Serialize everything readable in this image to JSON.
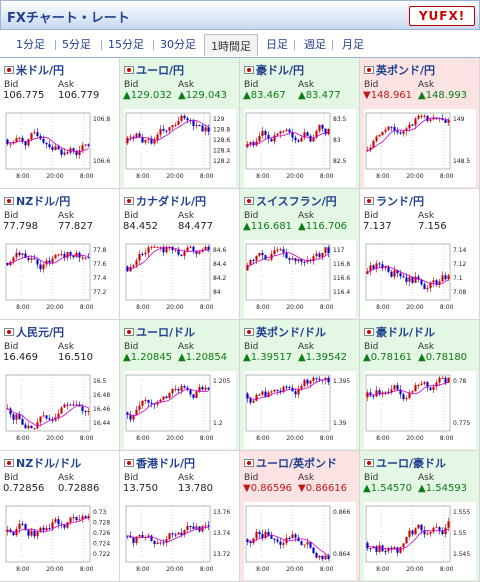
{
  "header": {
    "title": "FXチャート・レート",
    "logo": "YUFX!"
  },
  "tabs": [
    {
      "label": "1分足"
    },
    {
      "label": "5分足"
    },
    {
      "label": "15分足"
    },
    {
      "label": "30分足"
    },
    {
      "label": "1時間足"
    },
    {
      "label": "日足"
    },
    {
      "label": "週足"
    },
    {
      "label": "月足"
    }
  ],
  "active_tab": 4,
  "labels": {
    "bid": "Bid",
    "ask": "Ask"
  },
  "x_ticks": [
    "8:00",
    "20:00",
    "8:00"
  ],
  "colors": {
    "up_bg": "#e4f6e4",
    "down_bg": "#fbe3e3",
    "up_candle": "#c00",
    "down_candle": "#00c",
    "ma": "#c0c"
  },
  "pairs": [
    {
      "name": "米ドル/円",
      "bid": "106.775",
      "ask": "106.779",
      "trend": "neutral",
      "yticks": [
        "106.8",
        "106.6"
      ]
    },
    {
      "name": "ユーロ/円",
      "bid": "▲129.032",
      "ask": "▲129.043",
      "trend": "up",
      "yticks": [
        "129",
        "128.8",
        "128.6",
        "128.4",
        "128.2"
      ]
    },
    {
      "name": "豪ドル/円",
      "bid": "▲83.467",
      "ask": "▲83.477",
      "trend": "up",
      "yticks": [
        "83.5",
        "83",
        "82.5"
      ]
    },
    {
      "name": "英ポンド/円",
      "bid": "▼148.961",
      "ask": "▲148.993",
      "trend": "down",
      "yticks": [
        "149",
        "148.5"
      ]
    },
    {
      "name": "NZドル/円",
      "bid": "77.798",
      "ask": "77.827",
      "trend": "neutral",
      "yticks": [
        "77.8",
        "77.6",
        "77.4",
        "77.2"
      ]
    },
    {
      "name": "カナダドル/円",
      "bid": "84.452",
      "ask": "84.477",
      "trend": "neutral",
      "yticks": [
        "84.6",
        "84.4",
        "84.2",
        "84"
      ]
    },
    {
      "name": "スイスフラン/円",
      "bid": "▲116.681",
      "ask": "▲116.706",
      "trend": "up",
      "yticks": [
        "117",
        "116.8",
        "116.6",
        "116.4"
      ]
    },
    {
      "name": "ランド/円",
      "bid": "7.137",
      "ask": "7.156",
      "trend": "neutral",
      "yticks": [
        "7.14",
        "7.12",
        "7.1",
        "7.08"
      ]
    },
    {
      "name": "人民元/円",
      "bid": "16.469",
      "ask": "16.510",
      "trend": "neutral",
      "yticks": [
        "16.5",
        "16.48",
        "16.46",
        "16.44"
      ]
    },
    {
      "name": "ユーロ/ドル",
      "bid": "▲1.20845",
      "ask": "▲1.20854",
      "trend": "up",
      "yticks": [
        "1.205",
        "1.2"
      ]
    },
    {
      "name": "英ポンド/ドル",
      "bid": "▲1.39517",
      "ask": "▲1.39542",
      "trend": "up",
      "yticks": [
        "1.395",
        "1.39"
      ]
    },
    {
      "name": "豪ドル/ドル",
      "bid": "▲0.78161",
      "ask": "▲0.78180",
      "trend": "up",
      "yticks": [
        "0.78",
        "0.775"
      ]
    },
    {
      "name": "NZドル/ドル",
      "bid": "0.72856",
      "ask": "0.72886",
      "trend": "neutral",
      "yticks": [
        "0.73",
        "0.728",
        "0.726",
        "0.724",
        "0.722"
      ]
    },
    {
      "name": "香港ドル/円",
      "bid": "13.750",
      "ask": "13.780",
      "trend": "neutral",
      "yticks": [
        "13.76",
        "13.74",
        "13.72"
      ]
    },
    {
      "name": "ユーロ/英ポンド",
      "bid": "▼0.86596",
      "ask": "▼0.86616",
      "trend": "down",
      "yticks": [
        "0.866",
        "0.864"
      ]
    },
    {
      "name": "ユーロ/豪ドル",
      "bid": "▲1.54570",
      "ask": "▲1.54593",
      "trend": "up",
      "yticks": [
        "1.555",
        "1.55",
        "1.545"
      ]
    }
  ]
}
